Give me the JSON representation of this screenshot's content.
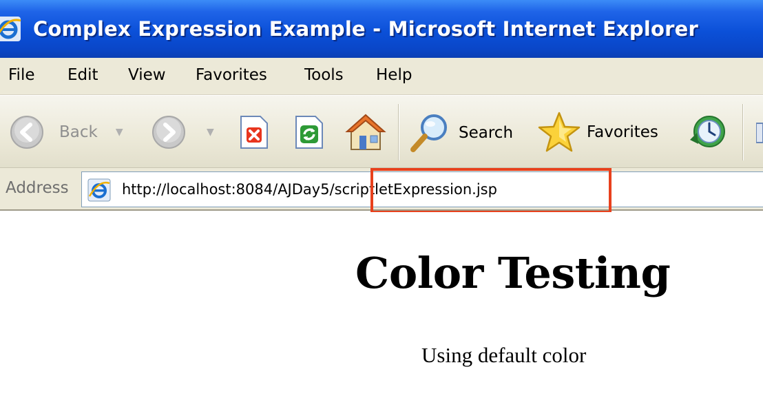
{
  "window": {
    "title": "Complex Expression Example - Microsoft Internet Explorer"
  },
  "menu": {
    "items": [
      "File",
      "Edit",
      "View",
      "Favorites",
      "Tools",
      "Help"
    ]
  },
  "toolbar": {
    "back_label": "Back",
    "search_label": "Search",
    "favorites_label": "Favorites",
    "icons": [
      "back-icon",
      "forward-icon",
      "stop-icon",
      "refresh-icon",
      "home-icon",
      "search-icon",
      "favorites-icon",
      "history-icon"
    ]
  },
  "address": {
    "label": "Address",
    "url": "http://localhost:8084/AJDay5/scriptletExpression.jsp",
    "highlight_color": "#e8411d"
  },
  "page": {
    "heading": "Color Testing",
    "text": "Using default color"
  },
  "colors": {
    "titlebar": "#0b50d8",
    "chrome": "#ece9d8"
  }
}
